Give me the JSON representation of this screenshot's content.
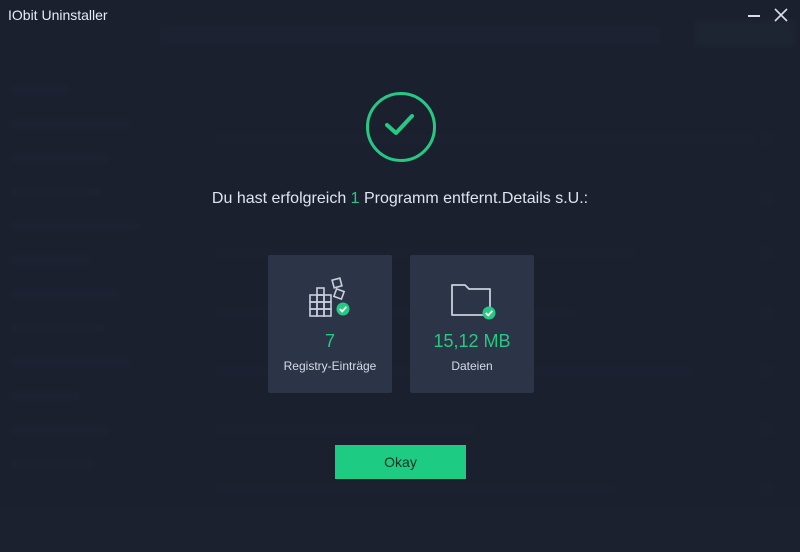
{
  "window": {
    "title": "IObit Uninstaller",
    "controls": [
      "minimize-icon",
      "close-icon"
    ]
  },
  "result": {
    "icon": "checkmark-circle-icon",
    "message_prefix": "Du hast erfolgreich ",
    "removed_count": "1",
    "message_suffix": " Programm entfernt.Details s.U.:"
  },
  "stats": [
    {
      "icon": "registry-blocks-icon",
      "value": "7",
      "label": "Registry-Einträge"
    },
    {
      "icon": "folder-check-icon",
      "value": "15,12 MB",
      "label": "Dateien"
    }
  ],
  "actions": {
    "okay_label": "Okay"
  },
  "colors": {
    "accent": "#25c983",
    "button": "#1ecb83",
    "background": "#1e2433",
    "card": "#2c3447"
  }
}
